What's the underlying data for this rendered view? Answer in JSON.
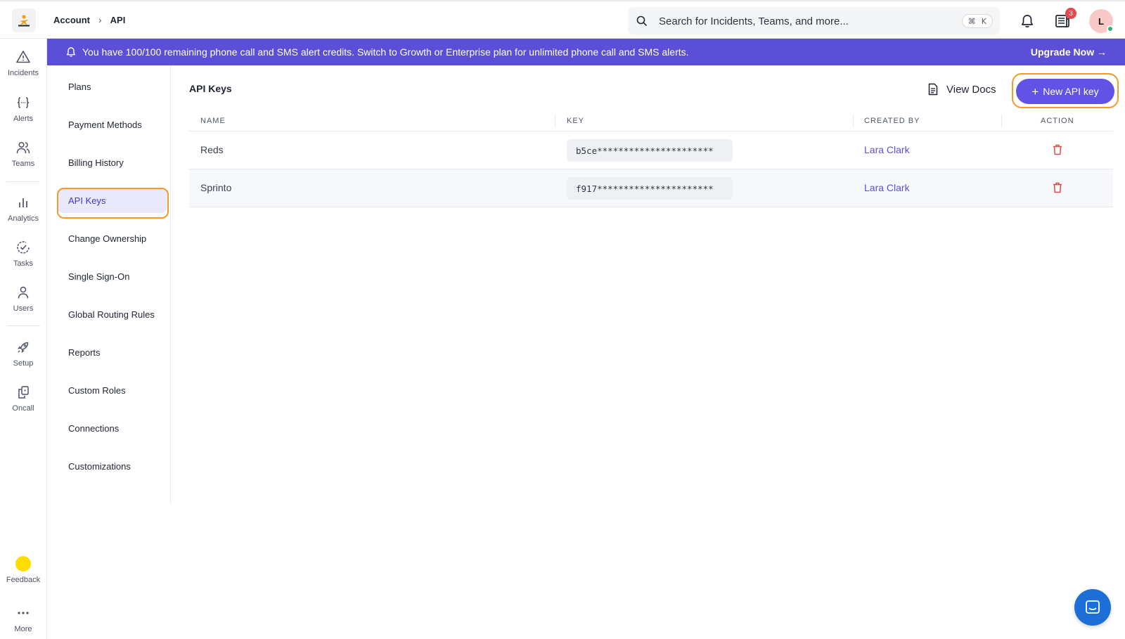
{
  "breadcrumb": {
    "parent": "Account",
    "current": "API"
  },
  "search": {
    "placeholder": "Search for Incidents, Teams, and more...",
    "shortcut_symbol": "⌘",
    "shortcut_key": "K"
  },
  "notifications": {
    "badge_count": "3"
  },
  "user": {
    "avatar_initial": "L"
  },
  "rail": {
    "items": [
      {
        "label": "Incidents",
        "icon": "warning-icon"
      },
      {
        "label": "Alerts",
        "icon": "braces-icon"
      },
      {
        "label": "Teams",
        "icon": "team-icon"
      },
      {
        "label": "Analytics",
        "icon": "bar-chart-icon"
      },
      {
        "label": "Tasks",
        "icon": "check-circle-icon"
      },
      {
        "label": "Users",
        "icon": "user-icon"
      },
      {
        "label": "Setup",
        "icon": "rocket-icon"
      },
      {
        "label": "Oncall",
        "icon": "oncall-icon"
      }
    ],
    "feedback_label": "Feedback",
    "more_label": "More"
  },
  "banner": {
    "message": "You have 100/100 remaining phone call and SMS alert credits. Switch to Growth or Enterprise plan for unlimited phone call and SMS alerts.",
    "upgrade_label": "Upgrade Now →"
  },
  "settings_nav": {
    "items": [
      "Plans",
      "Payment Methods",
      "Billing History",
      "API Keys",
      "Change Ownership",
      "Single Sign-On",
      "Global Routing Rules",
      "Reports",
      "Custom Roles",
      "Connections",
      "Customizations"
    ],
    "active": "API Keys"
  },
  "main": {
    "title": "API Keys",
    "view_docs_label": "View Docs",
    "new_key_label": "New API key"
  },
  "table": {
    "headers": {
      "name": "NAME",
      "key": "KEY",
      "created_by": "CREATED BY",
      "action": "ACTION"
    },
    "rows": [
      {
        "name": "Reds",
        "key": "b5ce**********************",
        "created_by": "Lara Clark"
      },
      {
        "name": "Sprinto",
        "key": "f917**********************",
        "created_by": "Lara Clark"
      }
    ]
  },
  "colors": {
    "accent": "#5b4fd8",
    "highlight": "#f39a2b",
    "delete": "#e5484d",
    "chat": "#1b6fd6"
  }
}
